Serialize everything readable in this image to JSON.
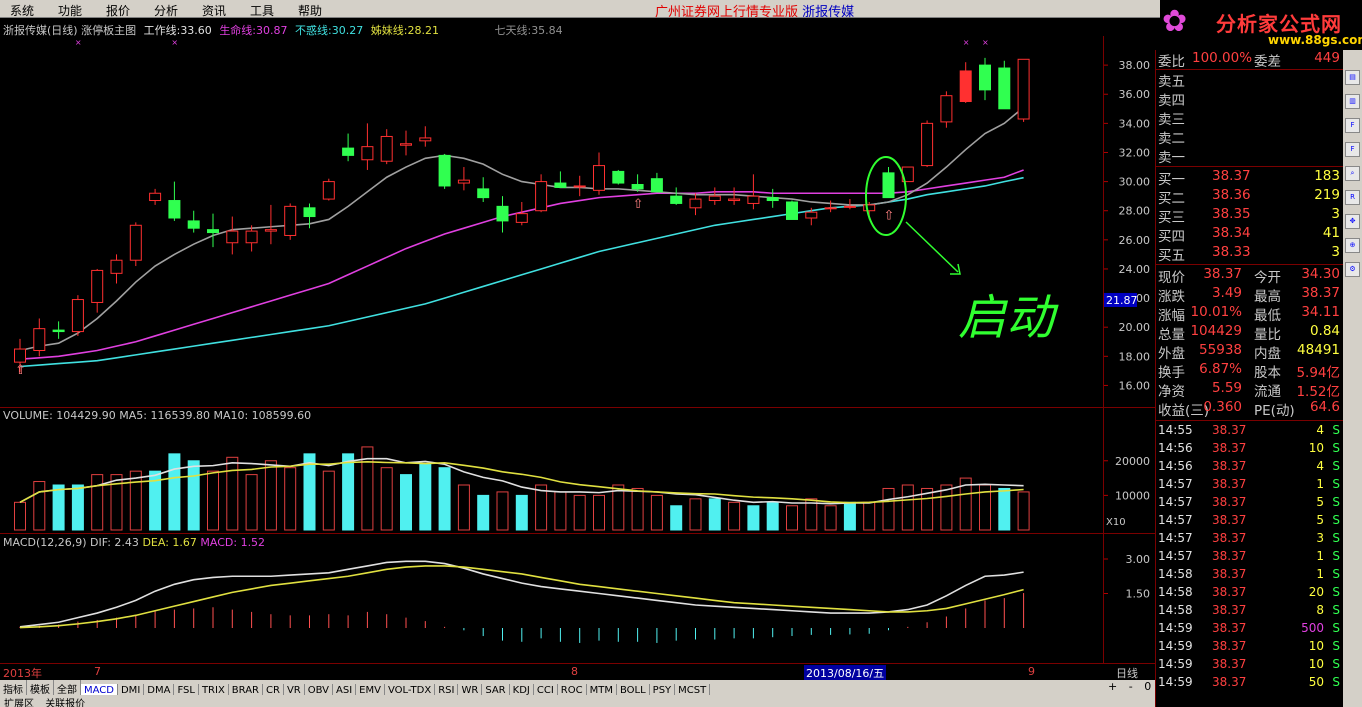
{
  "menu": {
    "items": [
      "系统",
      "功能",
      "报价",
      "分析",
      "资讯",
      "工具",
      "帮助"
    ],
    "title_source": "广州证券网上行情专业版",
    "title_stock": "浙报传媒"
  },
  "logo": {
    "name": "分析家公式网",
    "url": "www.88gs.com"
  },
  "main_header": {
    "stock": "浙报传媒(日线)",
    "indicator": "涨停板主图",
    "lines": [
      {
        "label": "工作线:",
        "value": "33.60",
        "color": "#e0e0e0"
      },
      {
        "label": "生命线:",
        "value": "30.87",
        "color": "#e040e0"
      },
      {
        "label": "不惑线:",
        "value": "30.27",
        "color": "#40e0e0"
      },
      {
        "label": "姊妹线:",
        "value": "28.21",
        "color": "#e0e040"
      },
      {
        "label": "七天线:",
        "value": "35.84",
        "color": "#909090"
      }
    ]
  },
  "price_axis": [
    "38.00",
    "36.00",
    "34.00",
    "32.00",
    "30.00",
    "28.00",
    "26.00",
    "24.00",
    "22.00",
    "20.00",
    "18.00",
    "16.00"
  ],
  "price_marker": "21.87",
  "annotation": "启动",
  "volume_header": {
    "label": "VOLUME: 104429.90",
    "ma5": "MA5: 116539.80",
    "ma10": "MA10: 108599.60"
  },
  "volume_axis": [
    "20000",
    "10000"
  ],
  "volume_unit": "X10",
  "macd_header": {
    "label": "MACD(12,26,9)",
    "dif": "DIF: 2.43",
    "dea": "DEA: 1.67",
    "macd": "MACD: 1.52"
  },
  "macd_axis": [
    "3.00",
    "1.50"
  ],
  "date_axis": {
    "year": "2013年",
    "m7": "7",
    "m8": "8",
    "selected": "2013/08/16/五",
    "m9": "9",
    "period": "日线"
  },
  "tabs": [
    "指标",
    "模板",
    "全部",
    "MACD",
    "DMI",
    "DMA",
    "FSL",
    "TRIX",
    "BRAR",
    "CR",
    "VR",
    "OBV",
    "ASI",
    "EMV",
    "VOL-TDX",
    "RSI",
    "WR",
    "SAR",
    "KDJ",
    "CCI",
    "ROC",
    "MTM",
    "BOLL",
    "PSY",
    "MCST"
  ],
  "tab_controls": [
    "+",
    "-",
    "0"
  ],
  "bottom_bar": [
    "扩展区",
    "关联报价"
  ],
  "quote": {
    "weibi": {
      "label": "委比",
      "value": "100.00%",
      "label2": "委差",
      "value2": "449"
    },
    "sell": [
      {
        "label": "卖五"
      },
      {
        "label": "卖四"
      },
      {
        "label": "卖三"
      },
      {
        "label": "卖二"
      },
      {
        "label": "卖一"
      }
    ],
    "buy": [
      {
        "label": "买一",
        "price": "38.37",
        "vol": "183"
      },
      {
        "label": "买二",
        "price": "38.36",
        "vol": "219"
      },
      {
        "label": "买三",
        "price": "38.35",
        "vol": "3"
      },
      {
        "label": "买四",
        "price": "38.34",
        "vol": "41"
      },
      {
        "label": "买五",
        "price": "38.33",
        "vol": "3"
      }
    ],
    "stats": [
      {
        "l1": "现价",
        "v1": "38.37",
        "l2": "今开",
        "v2": "34.30"
      },
      {
        "l1": "涨跌",
        "v1": "3.49",
        "l2": "最高",
        "v2": "38.37"
      },
      {
        "l1": "涨幅",
        "v1": "10.01%",
        "l2": "最低",
        "v2": "34.11"
      },
      {
        "l1": "总量",
        "v1": "104429",
        "l2": "量比",
        "v2": "0.84"
      },
      {
        "l1": "外盘",
        "v1": "55938",
        "l2": "内盘",
        "v2": "48491"
      },
      {
        "l1": "换手",
        "v1": "6.87%",
        "l2": "股本",
        "v2": "5.94亿"
      },
      {
        "l1": "净资",
        "v1": "5.59",
        "l2": "流通",
        "v2": "1.52亿"
      },
      {
        "l1": "收益(三)",
        "v1": "0.360",
        "l2": "PE(动)",
        "v2": "64.6"
      }
    ],
    "ticks": [
      {
        "t": "14:55",
        "p": "38.37",
        "v": "4",
        "s": "S"
      },
      {
        "t": "14:56",
        "p": "38.37",
        "v": "10",
        "s": "S"
      },
      {
        "t": "14:56",
        "p": "38.37",
        "v": "4",
        "s": "S"
      },
      {
        "t": "14:57",
        "p": "38.37",
        "v": "1",
        "s": "S"
      },
      {
        "t": "14:57",
        "p": "38.37",
        "v": "5",
        "s": "S"
      },
      {
        "t": "14:57",
        "p": "38.37",
        "v": "5",
        "s": "S"
      },
      {
        "t": "14:57",
        "p": "38.37",
        "v": "3",
        "s": "S"
      },
      {
        "t": "14:57",
        "p": "38.37",
        "v": "1",
        "s": "S"
      },
      {
        "t": "14:58",
        "p": "38.37",
        "v": "1",
        "s": "S"
      },
      {
        "t": "14:58",
        "p": "38.37",
        "v": "20",
        "s": "S"
      },
      {
        "t": "14:58",
        "p": "38.37",
        "v": "8",
        "s": "S"
      },
      {
        "t": "14:59",
        "p": "38.37",
        "v": "500",
        "s": "S"
      },
      {
        "t": "14:59",
        "p": "38.37",
        "v": "10",
        "s": "S"
      },
      {
        "t": "14:59",
        "p": "38.37",
        "v": "10",
        "s": "S"
      },
      {
        "t": "14:59",
        "p": "38.37",
        "v": "50",
        "s": "S"
      }
    ]
  },
  "toolbar_icons": [
    "chart-icon",
    "kline-icon",
    "f10-icon",
    "f5-icon",
    "search-icon",
    "rsi-icon",
    "arrows-icon",
    "zoom-icon",
    "settings-icon"
  ],
  "chart_data": {
    "type": "candlestick",
    "ylim": [
      15,
      40
    ],
    "candles": [
      [
        17.6,
        19.2,
        16.9,
        18.5
      ],
      [
        18.4,
        20.6,
        18.0,
        19.9
      ],
      [
        19.8,
        20.4,
        19.2,
        19.7
      ],
      [
        19.7,
        22.2,
        19.4,
        21.9
      ],
      [
        21.7,
        24.0,
        21.0,
        23.9
      ],
      [
        23.7,
        25.0,
        23.0,
        24.6
      ],
      [
        24.6,
        27.2,
        24.2,
        27.0
      ],
      [
        28.7,
        29.5,
        28.4,
        29.2
      ],
      [
        28.7,
        30.0,
        27.3,
        27.5
      ],
      [
        27.3,
        28.0,
        26.5,
        26.8
      ],
      [
        26.7,
        27.8,
        25.5,
        26.5
      ],
      [
        25.8,
        27.6,
        25.0,
        26.6
      ],
      [
        25.8,
        27.0,
        25.2,
        26.6
      ],
      [
        26.6,
        28.4,
        25.7,
        26.7
      ],
      [
        26.3,
        28.5,
        26.0,
        28.3
      ],
      [
        28.2,
        28.5,
        26.8,
        27.6
      ],
      [
        28.8,
        30.2,
        28.7,
        30.0
      ],
      [
        32.3,
        33.3,
        31.4,
        31.8
      ],
      [
        31.5,
        34.0,
        30.8,
        32.4
      ],
      [
        31.4,
        33.6,
        31.2,
        33.1
      ],
      [
        32.5,
        33.5,
        31.8,
        32.6
      ],
      [
        32.8,
        33.8,
        32.4,
        33.0
      ],
      [
        31.8,
        31.9,
        29.5,
        29.7
      ],
      [
        29.9,
        31.0,
        29.4,
        30.1
      ],
      [
        29.5,
        30.3,
        28.6,
        28.9
      ],
      [
        28.3,
        29.0,
        26.5,
        27.3
      ],
      [
        27.2,
        28.6,
        27.0,
        27.8
      ],
      [
        28.0,
        30.5,
        27.9,
        30.0
      ],
      [
        29.9,
        30.7,
        29.6,
        29.6
      ],
      [
        29.7,
        30.4,
        29.0,
        29.7
      ],
      [
        29.4,
        32.0,
        29.1,
        31.1
      ],
      [
        30.7,
        30.8,
        29.8,
        29.9
      ],
      [
        29.8,
        30.5,
        29.3,
        29.5
      ],
      [
        30.2,
        30.6,
        29.3,
        29.3
      ],
      [
        29.0,
        29.6,
        28.4,
        28.5
      ],
      [
        28.2,
        29.2,
        27.7,
        28.8
      ],
      [
        28.7,
        29.6,
        28.4,
        29.0
      ],
      [
        28.7,
        29.6,
        28.4,
        28.8
      ],
      [
        28.5,
        30.5,
        28.1,
        29.0
      ],
      [
        28.9,
        29.5,
        28.2,
        28.7
      ],
      [
        28.6,
        28.7,
        27.4,
        27.4
      ],
      [
        27.5,
        28.2,
        27.0,
        27.9
      ],
      [
        28.2,
        28.7,
        27.9,
        28.2
      ],
      [
        28.3,
        28.8,
        28.1,
        28.3
      ],
      [
        28.0,
        28.6,
        27.4,
        28.4
      ],
      [
        30.6,
        31.0,
        28.9,
        28.9
      ],
      [
        30.0,
        31.0,
        30.4,
        31.0
      ],
      [
        31.1,
        34.2,
        31.0,
        34.0
      ],
      [
        34.1,
        36.2,
        33.7,
        35.9
      ],
      [
        35.5,
        38.2,
        35.4,
        37.6
      ],
      [
        38.0,
        38.5,
        35.6,
        36.3
      ],
      [
        37.8,
        38.3,
        35.9,
        35.0
      ],
      [
        34.3,
        38.4,
        34.1,
        38.4
      ]
    ],
    "ma_work": [
      18.4,
      18.7,
      18.9,
      19.6,
      20.6,
      21.8,
      23.1,
      24.2,
      25.0,
      25.7,
      26.3,
      26.7,
      26.8,
      26.9,
      27.0,
      27.1,
      27.4,
      28.3,
      29.3,
      30.3,
      31.0,
      31.6,
      31.8,
      31.6,
      31.2,
      30.5,
      30.0,
      29.8,
      29.6,
      29.6,
      29.5,
      29.5,
      29.4,
      29.3,
      29.2,
      29.1,
      29.1,
      29.1,
      29.0,
      28.9,
      28.8,
      28.6,
      28.5,
      28.4,
      28.4,
      28.6,
      29.1,
      29.9,
      31.0,
      32.2,
      33.3,
      34.0,
      35.1
    ],
    "ma_life": [
      17.8,
      17.9,
      18.0,
      18.2,
      18.4,
      18.7,
      19.0,
      19.4,
      19.8,
      20.2,
      20.6,
      21.0,
      21.4,
      21.8,
      22.2,
      22.6,
      23.0,
      23.6,
      24.2,
      24.8,
      25.4,
      25.9,
      26.4,
      26.8,
      27.2,
      27.6,
      27.9,
      28.2,
      28.5,
      28.7,
      28.9,
      29.0,
      29.1,
      29.2,
      29.2,
      29.2,
      29.3,
      29.3,
      29.3,
      29.2,
      29.2,
      29.2,
      29.2,
      29.2,
      29.2,
      29.2,
      29.3,
      29.5,
      29.7,
      29.9,
      30.1,
      30.3,
      30.8
    ],
    "ma_bw": [
      17.3,
      17.4,
      17.5,
      17.6,
      17.7,
      17.9,
      18.1,
      18.3,
      18.5,
      18.7,
      18.9,
      19.1,
      19.3,
      19.5,
      19.7,
      19.9,
      20.1,
      20.4,
      20.7,
      21.0,
      21.3,
      21.6,
      22.0,
      22.4,
      22.8,
      23.2,
      23.6,
      24.0,
      24.4,
      24.8,
      25.2,
      25.5,
      25.8,
      26.1,
      26.4,
      26.7,
      27.0,
      27.2,
      27.4,
      27.6,
      27.8,
      28.0,
      28.2,
      28.3,
      28.4,
      28.6,
      28.8,
      29.1,
      29.3,
      29.5,
      29.7,
      30.0,
      30.27
    ],
    "volume": [
      8,
      14,
      13,
      13,
      16,
      16,
      17,
      17,
      22,
      20,
      17,
      21,
      16,
      20,
      18,
      22,
      17,
      22,
      24,
      18,
      16,
      19,
      18,
      13,
      10,
      11,
      10,
      13,
      11,
      10,
      10,
      13,
      12,
      10,
      7,
      9,
      9,
      8,
      7,
      8,
      7,
      9,
      7,
      8,
      8,
      12,
      13,
      12,
      13,
      15,
      13,
      12,
      11
    ],
    "vol_cyan": [
      false,
      false,
      true,
      true,
      false,
      false,
      false,
      true,
      true,
      true,
      false,
      false,
      false,
      false,
      false,
      true,
      false,
      true,
      false,
      false,
      true,
      true,
      true,
      false,
      true,
      false,
      true,
      false,
      false,
      false,
      false,
      false,
      false,
      false,
      true,
      false,
      true,
      false,
      true,
      true,
      false,
      false,
      false,
      true,
      false,
      false,
      false,
      false,
      false,
      false,
      false,
      true,
      false
    ],
    "macd_bar": [
      0.05,
      0.1,
      0.15,
      0.28,
      0.35,
      0.45,
      0.55,
      0.75,
      0.8,
      0.85,
      0.9,
      0.8,
      0.7,
      0.6,
      0.55,
      0.55,
      0.6,
      0.55,
      0.7,
      0.6,
      0.45,
      0.3,
      0.05,
      -0.1,
      -0.35,
      -0.55,
      -0.6,
      -0.45,
      -0.6,
      -0.65,
      -0.55,
      -0.6,
      -0.6,
      -0.65,
      -0.55,
      -0.5,
      -0.5,
      -0.45,
      -0.45,
      -0.4,
      -0.35,
      -0.3,
      -0.3,
      -0.28,
      -0.25,
      -0.1,
      0.05,
      0.25,
      0.5,
      0.85,
      1.2,
      1.3,
      1.52
    ],
    "dif": [
      0.05,
      0.15,
      0.25,
      0.45,
      0.65,
      0.9,
      1.2,
      1.6,
      1.9,
      2.1,
      2.2,
      2.25,
      2.25,
      2.25,
      2.3,
      2.35,
      2.4,
      2.55,
      2.7,
      2.85,
      2.9,
      2.9,
      2.8,
      2.6,
      2.35,
      2.15,
      1.95,
      1.8,
      1.7,
      1.6,
      1.5,
      1.4,
      1.3,
      1.2,
      1.1,
      1.0,
      0.95,
      0.9,
      0.85,
      0.8,
      0.75,
      0.7,
      0.65,
      0.65,
      0.65,
      0.7,
      0.8,
      1.0,
      1.4,
      1.85,
      2.25,
      2.3,
      2.43
    ],
    "dea": [
      0.02,
      0.05,
      0.1,
      0.18,
      0.28,
      0.4,
      0.55,
      0.75,
      0.95,
      1.15,
      1.35,
      1.55,
      1.7,
      1.85,
      1.95,
      2.05,
      2.15,
      2.25,
      2.4,
      2.55,
      2.65,
      2.7,
      2.7,
      2.65,
      2.55,
      2.45,
      2.35,
      2.2,
      2.05,
      1.9,
      1.8,
      1.7,
      1.6,
      1.5,
      1.4,
      1.3,
      1.2,
      1.1,
      1.05,
      1.0,
      0.95,
      0.9,
      0.85,
      0.8,
      0.75,
      0.7,
      0.7,
      0.75,
      0.85,
      1.05,
      1.25,
      1.45,
      1.67
    ]
  }
}
